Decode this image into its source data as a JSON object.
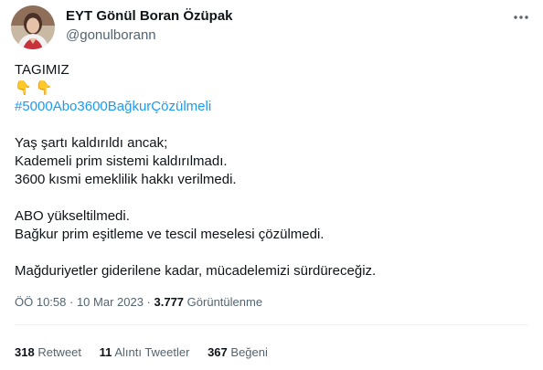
{
  "author": {
    "display_name": "EYT Gönül Boran Özüpak",
    "handle": "@gonulborann"
  },
  "tweet": {
    "lines": {
      "l1": "TAGIMIZ",
      "hashtag": "#5000Abo3600BağkurÇözülmeli",
      "l3": "Yaş şartı kaldırıldı ancak;",
      "l4": "Kademeli prim sistemi kaldırılmadı.",
      "l5": "3600 kısmi emeklilik hakkı verilmedi.",
      "l6": "ABO yükseltilmedi.",
      "l7": "Bağkur prim eşitleme ve tescil meselesi çözülmedi.",
      "l8": "Mağduriyetler giderilene kadar, mücadelemizi sürdüreceğiz."
    },
    "emoji": [
      "👇",
      "👇"
    ]
  },
  "meta": {
    "time": "ÖÖ 10:58",
    "sep1": " · ",
    "date": "10 Mar 2023",
    "sep2": " · ",
    "views_count": "3.777",
    "views_label": "Görüntülenme"
  },
  "stats": {
    "retweets": {
      "count": "318",
      "label": "Retweet"
    },
    "quotes": {
      "count": "11",
      "label": "Alıntı Tweetler"
    },
    "likes": {
      "count": "367",
      "label": "Beğeni"
    }
  },
  "icons": {
    "more": "more-dots-icon",
    "avatar": "profile-photo"
  },
  "colors": {
    "accent": "#1d9bf0",
    "text": "#0f1419",
    "secondary": "#536471",
    "divider": "#eff3f4"
  }
}
